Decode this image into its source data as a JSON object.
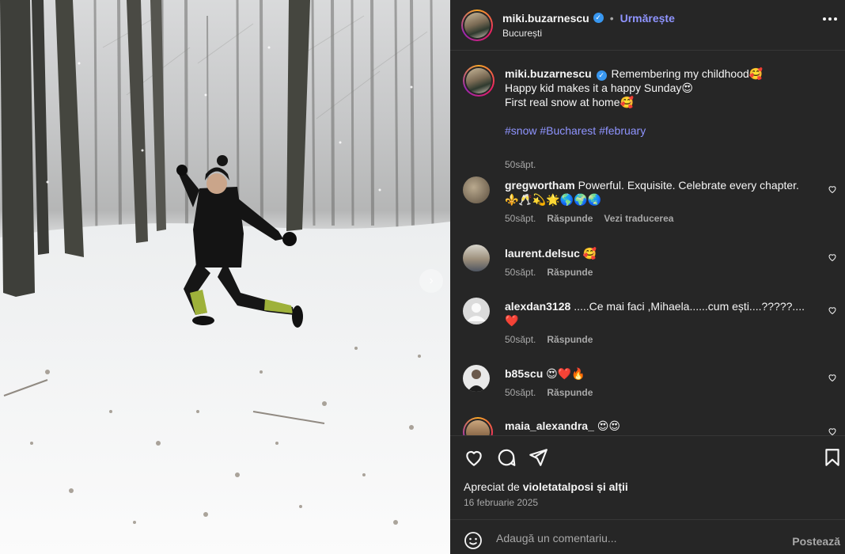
{
  "post": {
    "username": "miki.buzarnescu",
    "verified_mark": "✓",
    "separator": "•",
    "follow_label": "Urmărește",
    "location": "București"
  },
  "caption": {
    "username": "miki.buzarnescu",
    "line1": "Remembering my childhood🥰",
    "line2": "Happy kid makes it a happy Sunday😍",
    "line3": "First real snow at home🥰",
    "hashtags": "#snow #Bucharest #february",
    "time": "50săpt."
  },
  "comments": [
    {
      "username": "gregwortham",
      "text": "Powerful. Exquisite. Celebrate every chapter.",
      "text2": "⚜️🥂💫🌟🌎🌍🌏",
      "time": "50săpt.",
      "reply": "Răspunde",
      "translate": "Vezi traducerea"
    },
    {
      "username": "laurent.delsuc",
      "text": "🥰",
      "time": "50săpt.",
      "reply": "Răspunde"
    },
    {
      "username": "alexdan3128",
      "text": ".....Ce mai faci ,Mihaela......cum ești....?????....",
      "text2": "❤️",
      "time": "50săpt.",
      "reply": "Răspunde"
    },
    {
      "username": "b85scu",
      "text": "😍❤️🔥",
      "time": "50săpt.",
      "reply": "Răspunde"
    },
    {
      "username": "maia_alexandra_",
      "text": "😍😍"
    }
  ],
  "likes": {
    "prefix": "Apreciat de",
    "user": "violetatalposi",
    "suffix": "și alții"
  },
  "date": "16 februarie 2025",
  "add_comment": {
    "placeholder": "Adaugă un comentariu...",
    "post_label": "Postează"
  },
  "icons": {
    "like": "heart-icon",
    "comment": "comment-icon",
    "share": "share-icon",
    "save": "bookmark-icon",
    "emoji": "emoji-icon",
    "more": "more-icon",
    "next": "chevron-right-icon"
  },
  "colors": {
    "panel_bg": "#262626",
    "link": "#8f94ff",
    "verified": "#3897f0",
    "muted": "#a8a8a8"
  }
}
